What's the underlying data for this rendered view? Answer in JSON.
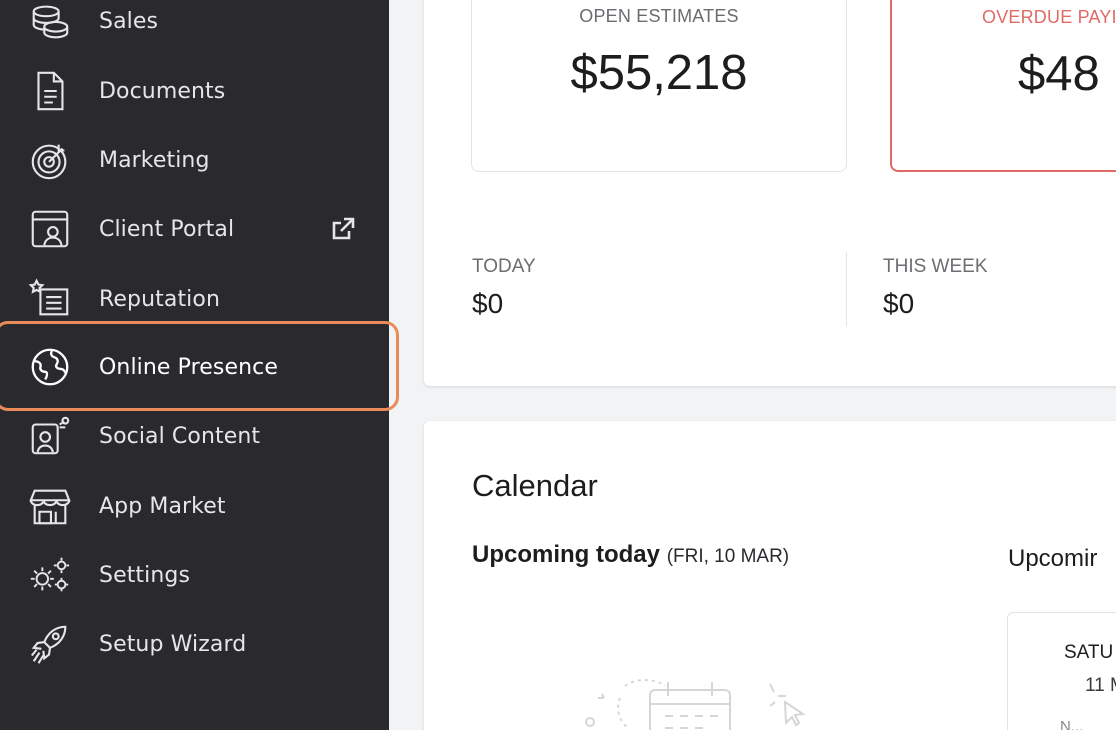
{
  "sidebar": {
    "items": [
      {
        "label": "Sales",
        "icon": "coins-icon"
      },
      {
        "label": "Documents",
        "icon": "document-icon"
      },
      {
        "label": "Marketing",
        "icon": "target-icon"
      },
      {
        "label": "Client Portal",
        "icon": "client-portal-icon",
        "external": true
      },
      {
        "label": "Reputation",
        "icon": "reputation-icon"
      },
      {
        "label": "Online Presence",
        "icon": "globe-icon",
        "highlighted": true
      },
      {
        "label": "Social Content",
        "icon": "social-content-icon"
      },
      {
        "label": "App Market",
        "icon": "storefront-icon"
      },
      {
        "label": "Settings",
        "icon": "gears-icon"
      },
      {
        "label": "Setup Wizard",
        "icon": "rocket-icon"
      }
    ],
    "highlight_color": "#e98c5a",
    "background": "#2a2a2e"
  },
  "summary": {
    "open_estimates": {
      "title": "OPEN ESTIMATES",
      "value": "$55,218"
    },
    "overdue_payments": {
      "title": "OVERDUE PAYI",
      "value": "$48",
      "color": "#e06a66"
    },
    "today": {
      "label": "TODAY",
      "value": "$0"
    },
    "this_week": {
      "label": "THIS WEEK",
      "value": "$0"
    }
  },
  "calendar": {
    "title": "Calendar",
    "upcoming_today": "Upcoming today",
    "upcoming_today_date": "(FRI, 10 MAR)",
    "upcoming_next": "Upcomir",
    "day_card": {
      "day": "SATU",
      "date": "11 M",
      "note": "N..."
    }
  }
}
